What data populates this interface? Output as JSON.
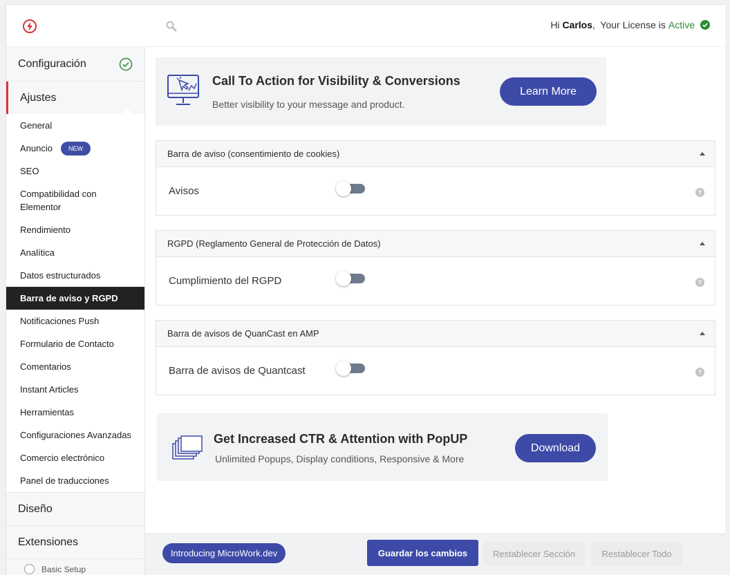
{
  "header": {
    "greeting": "Hi",
    "user": "Carlos",
    "license_text": ",  Your License is",
    "license_status": "Active",
    "logo_icon": "lightning-bolt-icon",
    "search_icon": "search-icon",
    "status_icon": "check-circle-icon"
  },
  "sidebar": {
    "configuracion": "Configuración",
    "ajustes": "Ajustes",
    "items": [
      {
        "label": "General"
      },
      {
        "label": "Anuncio",
        "badge": "NEW"
      },
      {
        "label": "SEO"
      },
      {
        "label": "Compatibilidad con Elementor"
      },
      {
        "label": "Rendimiento"
      },
      {
        "label": "Analítica"
      },
      {
        "label": "Datos estructurados"
      },
      {
        "label": "Barra de aviso y RGPD",
        "active": true
      },
      {
        "label": "Notificaciones Push"
      },
      {
        "label": "Formulario de Contacto"
      },
      {
        "label": "Comentarios"
      },
      {
        "label": "Instant Articles"
      },
      {
        "label": "Herramientas"
      },
      {
        "label": "Configuraciones Avanzadas"
      },
      {
        "label": "Comercio electrónico"
      },
      {
        "label": "Panel de traducciones"
      }
    ],
    "diseno": "Diseño",
    "extensiones": "Extensiones",
    "basic_setup": "Basic Setup"
  },
  "promo_top": {
    "title": "Call To Action for Visibility & Conversions",
    "subtitle": "Better visibility to your message and product.",
    "button": "Learn More"
  },
  "panels": [
    {
      "header": "Barra de aviso (consentimiento de cookies)",
      "field": "Avisos",
      "enabled": false
    },
    {
      "header": "RGPD (Reglamento General de Protección de Datos)",
      "field": "Cumplimiento del RGPD",
      "enabled": false
    },
    {
      "header": "Barra de avisos de QuanCast en AMP",
      "field": "Barra de avisos de Quantcast",
      "enabled": false
    }
  ],
  "help_glyph": "?",
  "promo_bottom": {
    "title": "Get Increased CTR & Attention with PopUP",
    "subtitle": "Unlimited Popups, Display conditions, Responsive & More",
    "button": "Download"
  },
  "footer": {
    "intro": "Introducing MicroWork.dev",
    "save": "Guardar los cambios",
    "reset_section": "Restablecer Sección",
    "reset_all": "Restablecer Todo"
  },
  "colors": {
    "accent": "#3d4aa8",
    "brand_red": "#d63638",
    "active_green": "#2d8a36"
  }
}
